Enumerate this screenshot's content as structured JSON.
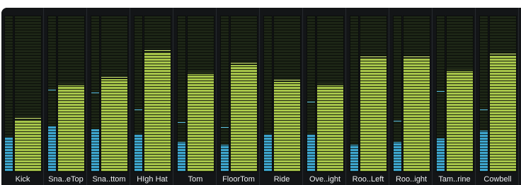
{
  "mixer": {
    "channels": [
      {
        "name": "Kick",
        "left_level": 0.22,
        "right_level": 0.33
      },
      {
        "name": "Sna..eTop",
        "left_level": 0.29,
        "right_level": 0.55,
        "left_peak": 0.52
      },
      {
        "name": "Sna..ttom",
        "left_level": 0.27,
        "right_level": 0.59,
        "left_peak": 0.5
      },
      {
        "name": "HIgh Hat",
        "left_level": 0.24,
        "right_level": 0.76,
        "left_peak": 0.39
      },
      {
        "name": "Tom",
        "left_level": 0.19,
        "right_level": 0.62,
        "left_peak": 0.31
      },
      {
        "name": "FloorTom",
        "left_level": 0.17,
        "right_level": 0.68,
        "left_peak": 0.28
      },
      {
        "name": "Ride",
        "left_level": 0.24,
        "right_level": 0.57
      },
      {
        "name": "Ove..ight",
        "left_level": 0.24,
        "right_level": 0.55,
        "left_peak": 0.44
      },
      {
        "name": "Roo..Left",
        "left_level": 0.17,
        "right_level": 0.72
      },
      {
        "name": "Roo..ight",
        "left_level": 0.19,
        "right_level": 0.72,
        "left_peak": 0.32
      },
      {
        "name": "Tam..rine",
        "left_level": 0.21,
        "right_level": 0.64,
        "left_peak": 0.51
      },
      {
        "name": "Cowbell",
        "left_level": 0.26,
        "right_level": 0.74,
        "left_peak": 0.39
      }
    ]
  },
  "colors": {
    "panel_background": "#141619",
    "meter_background": "#1d2616",
    "level_blue": "#3ea7cf",
    "level_green": "#a7c64a",
    "label_text": "#eef0f2"
  }
}
